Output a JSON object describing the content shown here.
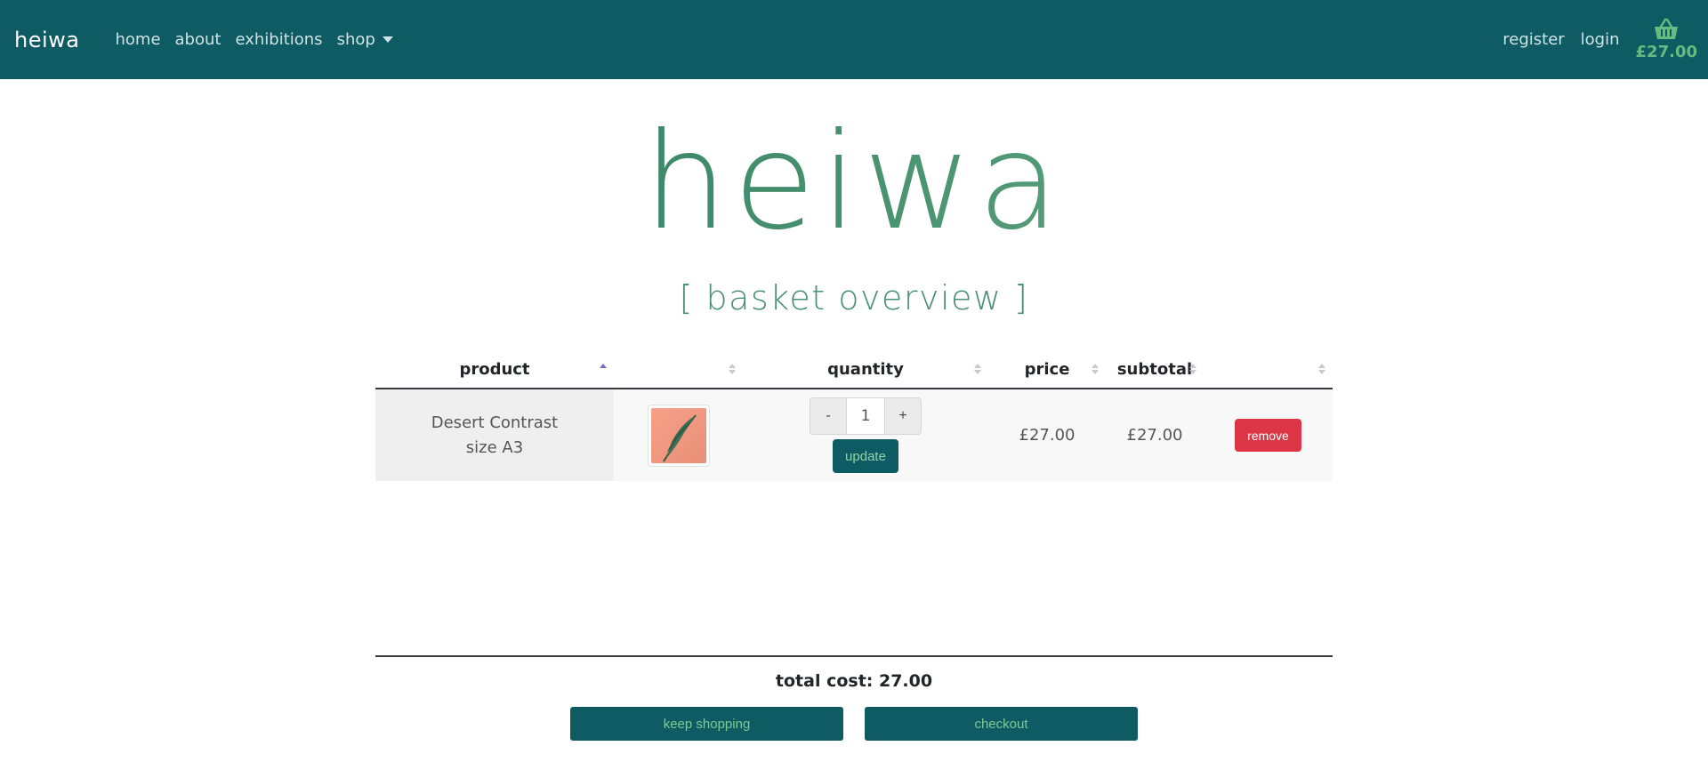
{
  "nav": {
    "brand": "heiwa",
    "links": [
      "home",
      "about",
      "exhibitions"
    ],
    "shop_label": "shop",
    "register": "register",
    "login": "login",
    "basket_total": "£27.00"
  },
  "hero": {
    "title": "heiwa",
    "subtitle": "[ basket overview ]"
  },
  "table": {
    "headers": [
      "product",
      "",
      "quantity",
      "price",
      "subtotal",
      ""
    ],
    "rows": [
      {
        "product_name": "Desert Contrast",
        "size": "size A3",
        "quantity": "1",
        "minus_label": "-",
        "plus_label": "+",
        "update_label": "update",
        "price": "£27.00",
        "subtotal": "£27.00",
        "remove_label": "remove"
      }
    ]
  },
  "summary": {
    "total_text": "total cost: 27.00",
    "keep_shopping": "keep shopping",
    "checkout": "checkout"
  },
  "colors": {
    "navbar": "#0f5b63",
    "accent_green": "#66bb80",
    "danger": "#dc3545"
  },
  "icons": {
    "basket": "basket-icon",
    "sort": "sort-icon",
    "dropdown": "caret-down-icon"
  }
}
